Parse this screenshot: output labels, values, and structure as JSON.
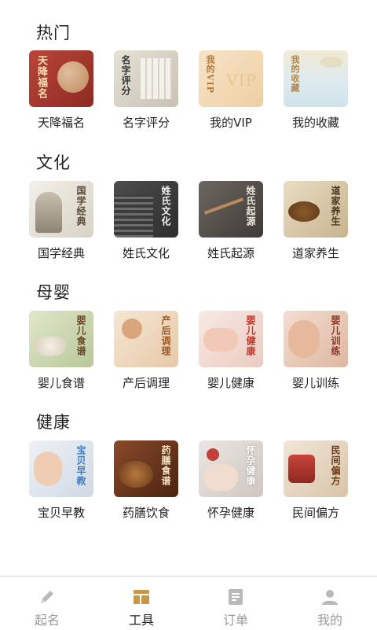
{
  "sections": [
    {
      "title": "热门",
      "items": [
        {
          "label": "天降福名",
          "tile_text": "天降福名"
        },
        {
          "label": "名字评分",
          "tile_text": "名字评分"
        },
        {
          "label": "我的VIP",
          "tile_text": "我的VIP"
        },
        {
          "label": "我的收藏",
          "tile_text": "我的收藏"
        }
      ]
    },
    {
      "title": "文化",
      "items": [
        {
          "label": "国学经典",
          "tile_text": "国学经典"
        },
        {
          "label": "姓氏文化",
          "tile_text": "姓氏文化"
        },
        {
          "label": "姓氏起源",
          "tile_text": "姓氏起源"
        },
        {
          "label": "道家养生",
          "tile_text": "道家养生"
        }
      ]
    },
    {
      "title": "母婴",
      "items": [
        {
          "label": "婴儿食谱",
          "tile_text": "婴儿食谱"
        },
        {
          "label": "产后调理",
          "tile_text": "产后调理"
        },
        {
          "label": "婴儿健康",
          "tile_text": "婴儿健康"
        },
        {
          "label": "婴儿训练",
          "tile_text": "婴儿训练"
        }
      ]
    },
    {
      "title": "健康",
      "items": [
        {
          "label": "宝贝早教",
          "tile_text": "宝贝早教"
        },
        {
          "label": "药膳饮食",
          "tile_text": "药膳食谱"
        },
        {
          "label": "怀孕健康",
          "tile_text": "怀孕健康"
        },
        {
          "label": "民间偏方",
          "tile_text": "民间偏方"
        }
      ]
    }
  ],
  "tabbar": {
    "items": [
      {
        "label": "起名",
        "icon": "pen-icon"
      },
      {
        "label": "工具",
        "icon": "tools-icon"
      },
      {
        "label": "订单",
        "icon": "order-list-icon"
      },
      {
        "label": "我的",
        "icon": "user-icon"
      }
    ],
    "active_index": 1
  },
  "colors": {
    "active_icon": "#c9964a",
    "inactive_icon": "#b9b9b9",
    "divider": "#d6d6d6"
  }
}
